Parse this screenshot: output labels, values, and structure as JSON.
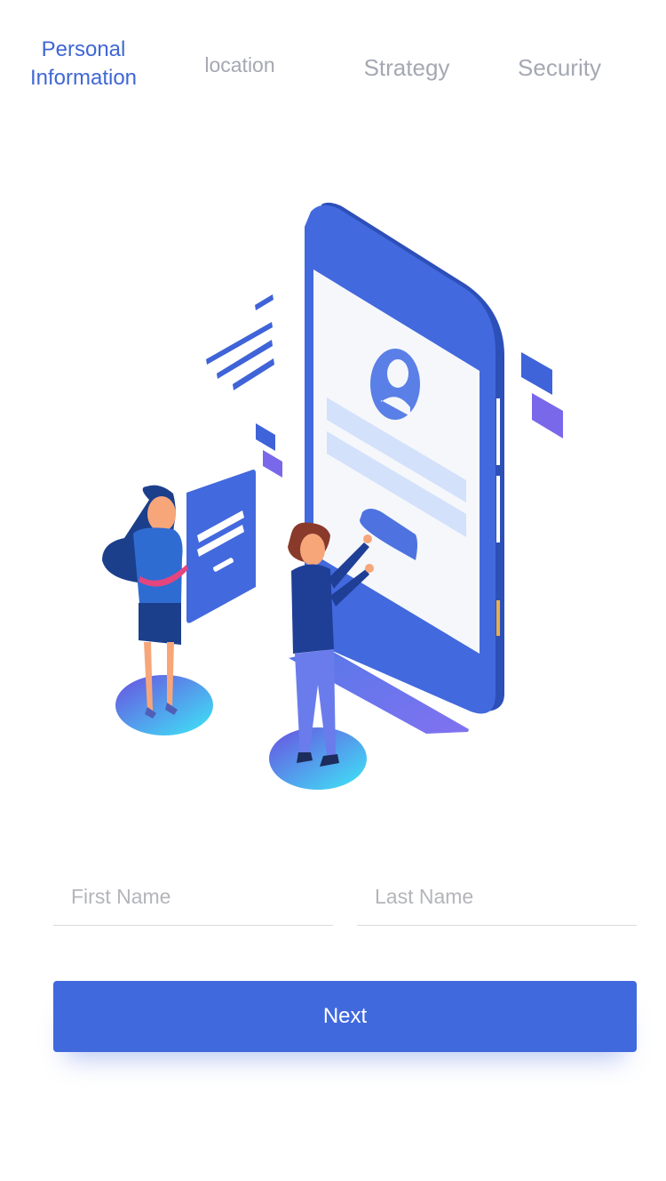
{
  "stepper": {
    "tabs": [
      {
        "label": "Personal\nInformation",
        "line1": "Personal",
        "line2": "Information",
        "active": true
      },
      {
        "label": "location",
        "active": false
      },
      {
        "label": "Strategy",
        "active": false
      },
      {
        "label": "Security",
        "active": false
      }
    ]
  },
  "form": {
    "first_name": {
      "placeholder": "First Name",
      "value": ""
    },
    "last_name": {
      "placeholder": "Last Name",
      "value": ""
    }
  },
  "actions": {
    "next_label": "Next"
  },
  "colors": {
    "accent": "#4169de",
    "active_tab": "#3f67d4",
    "inactive_tab": "#a5a8b3",
    "placeholder": "#b3b5ba"
  },
  "illustration": {
    "icon": "signup-phone-illustration"
  }
}
